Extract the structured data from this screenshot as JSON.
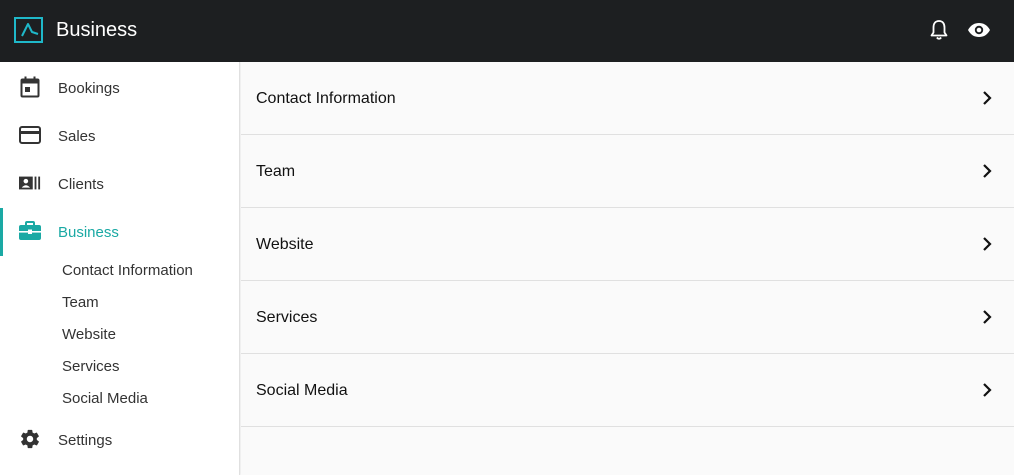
{
  "header": {
    "title": "Business",
    "logo_icon": "brand-logo-icon",
    "notifications_icon": "bell-icon",
    "preview_icon": "eye-icon"
  },
  "sidebar": {
    "items": [
      {
        "label": "Bookings",
        "icon": "calendar-icon"
      },
      {
        "label": "Sales",
        "icon": "credit-card-icon"
      },
      {
        "label": "Clients",
        "icon": "contacts-card-icon"
      },
      {
        "label": "Business",
        "icon": "briefcase-icon",
        "active": true
      },
      {
        "label": "Settings",
        "icon": "gear-icon"
      }
    ],
    "sub_items": [
      "Contact Information",
      "Team",
      "Website",
      "Services",
      "Social Media"
    ]
  },
  "main": {
    "rows": [
      {
        "label": "Contact Information"
      },
      {
        "label": "Team"
      },
      {
        "label": "Website"
      },
      {
        "label": "Services"
      },
      {
        "label": "Social Media"
      }
    ]
  },
  "colors": {
    "accent": "#1aa9a4",
    "topbar": "#1d1f21",
    "logo": "#1fb8c9"
  }
}
